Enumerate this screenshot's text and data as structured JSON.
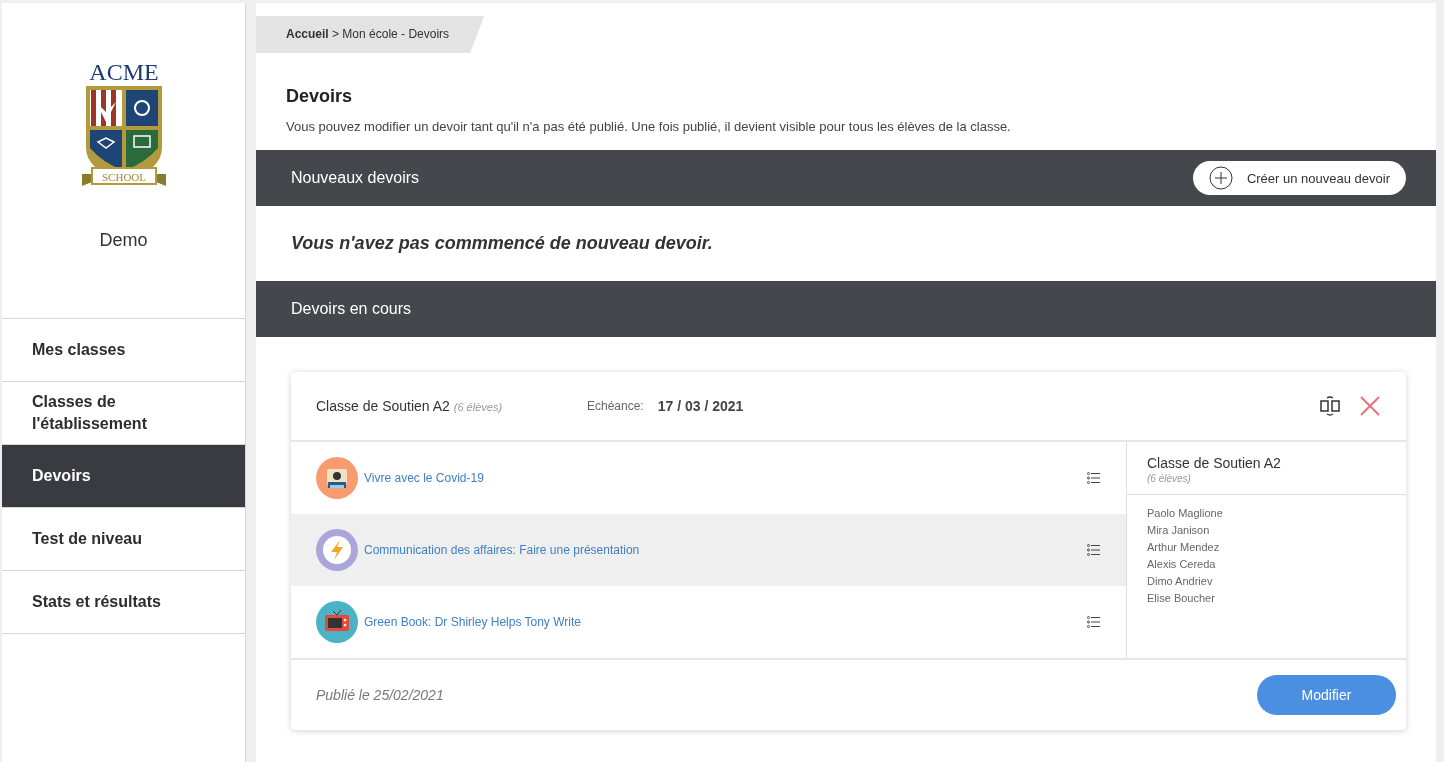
{
  "sidebar": {
    "logo": {
      "name": "ACME",
      "banner": "SCHOOL"
    },
    "school_name": "Demo",
    "items": [
      {
        "label": "Mes classes",
        "selected": false
      },
      {
        "label": "Classes de l'établissement",
        "selected": false
      },
      {
        "label": "Devoirs",
        "selected": true
      },
      {
        "label": "Test de niveau",
        "selected": false
      },
      {
        "label": "Stats et résultats",
        "selected": false
      }
    ]
  },
  "breadcrumb": "**Accueil** > Mon école - Devoirs",
  "page": {
    "title": "Devoirs",
    "description": "Vous pouvez modifier un devoir tant qu'il n'a pas été publié. Une fois publié, il devient visible pour tous les élèves de la classe."
  },
  "new_section": {
    "title": "Nouveaux devoirs",
    "action": "Créer un nouveau devoir",
    "empty_message": "Vous n'avez pas commmencé de nouveau devoir."
  },
  "current_section": {
    "title": "Devoirs en cours",
    "assignments": [
      {
        "class_name": "Classe de Soutien A2",
        "student_count": "(6 élèves)",
        "due_label": "Echéance:",
        "due_date": "17 / 03 / 2021",
        "lessons": [
          {
            "title": "Vivre avec le Covid-19",
            "kind": "camera",
            "selected": false
          },
          {
            "title": "Communication des affaires: Faire une présentation",
            "kind": "lightning",
            "selected": true
          },
          {
            "title": "Green Book: Dr Shirley Helps Tony Write",
            "kind": "tv",
            "selected": false
          }
        ],
        "roster": {
          "class_name": "Classe de Soutien A2",
          "student_count": "(6 élèves)",
          "students": [
            "Paolo Maglione",
            "Mira Janison",
            "Arthur Mendez",
            "Alexis Cereda",
            "Dimo Andriev",
            "Elise Boucher"
          ]
        },
        "published": "Publié le 25/02/2021",
        "button": "Modifier"
      }
    ]
  }
}
